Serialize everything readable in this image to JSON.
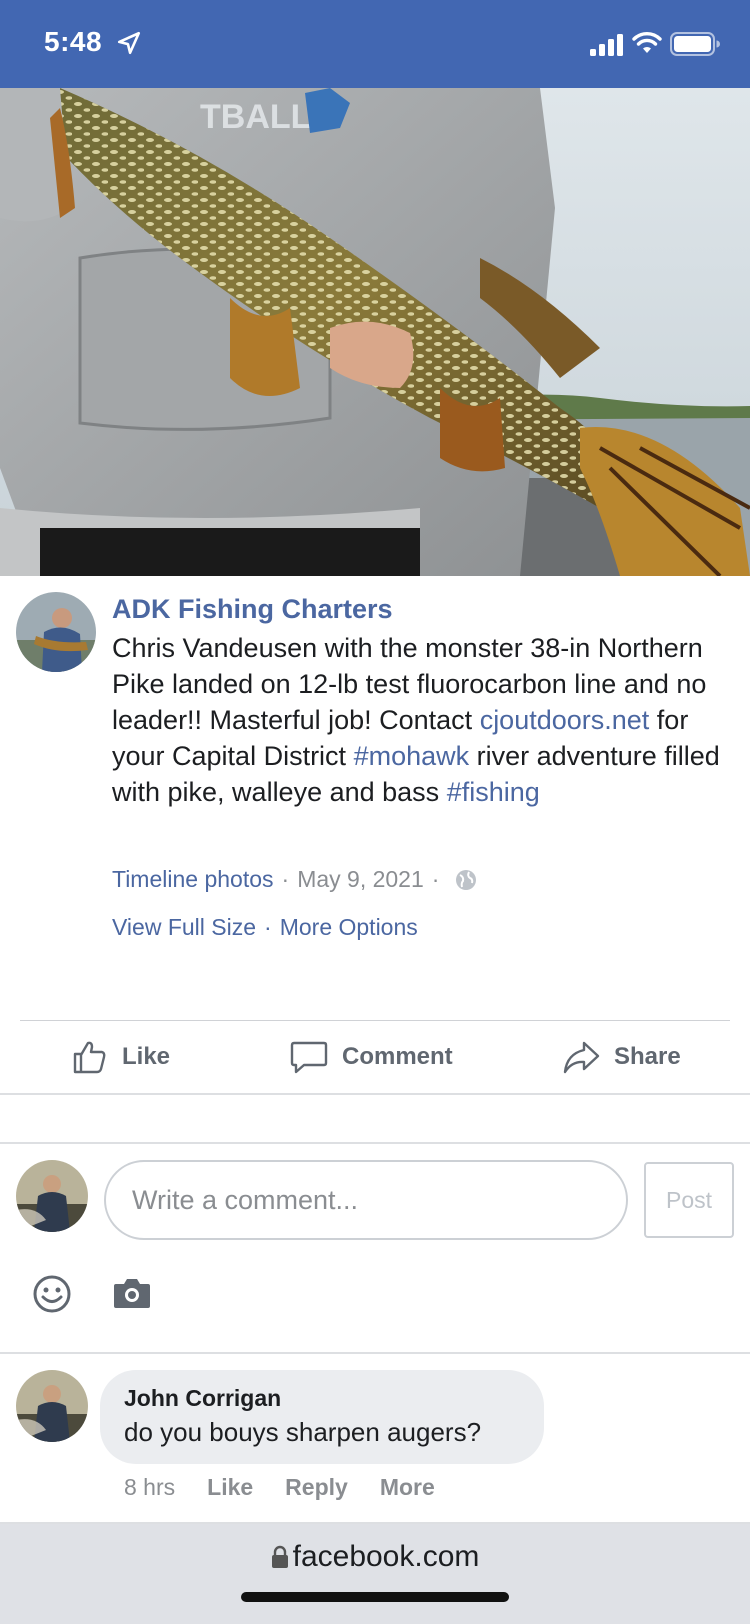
{
  "status_bar": {
    "time": "5:48",
    "icons": [
      "location-arrow-icon",
      "signal-icon",
      "wifi-icon",
      "battery-icon"
    ],
    "background": "#4267b2"
  },
  "post": {
    "author": "ADK Fishing Charters",
    "text_parts": {
      "p1": "Chris Vandeusen with the monster 38-in Northern Pike landed on 12-lb test fluorocarbon line and no leader!! Masterful job! Contact ",
      "link1": "cjoutdoors.net",
      "p2": " for your Capital District ",
      "tag1": "#mohawk",
      "p3": " river adventure filled with pike, walleye and bass ",
      "tag2": "#fishing"
    },
    "album": "Timeline photos",
    "date": "May 9, 2021",
    "separator": "·",
    "view_full_size": "View Full Size",
    "more_options": "More Options",
    "link_color": "#4b67a1"
  },
  "action_bar": {
    "like": "Like",
    "comment": "Comment",
    "share": "Share"
  },
  "composer": {
    "placeholder": "Write a comment...",
    "value": "",
    "post_label": "Post"
  },
  "comments": [
    {
      "author": "John Corrigan",
      "text": "do you bouys sharpen augers?",
      "time": "8 hrs",
      "like": "Like",
      "reply": "Reply",
      "more": "More"
    }
  ],
  "browser": {
    "url": "facebook.com"
  }
}
